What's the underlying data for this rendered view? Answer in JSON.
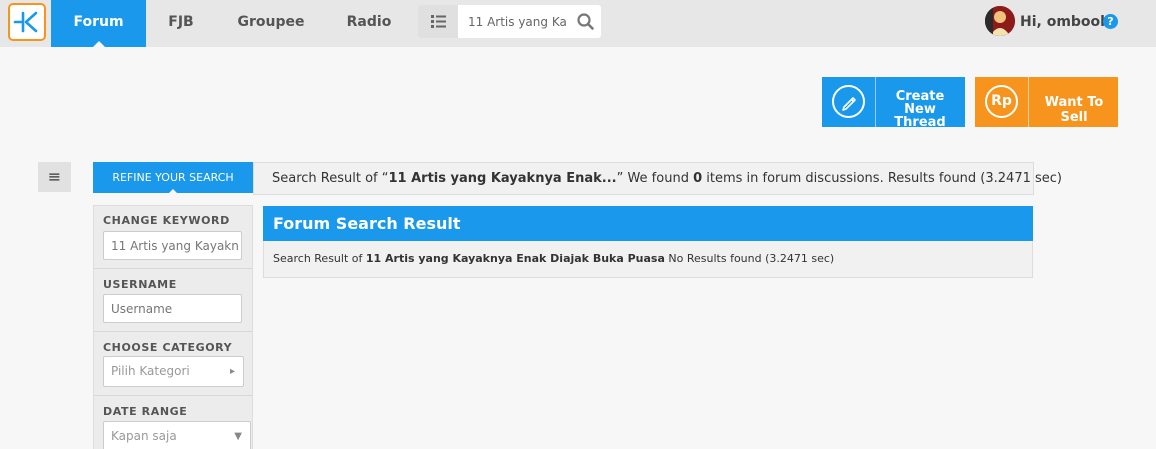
{
  "nav": {
    "tabs": [
      {
        "label": "Forum"
      },
      {
        "label": "FJB"
      },
      {
        "label": "Groupee"
      },
      {
        "label": "Radio"
      }
    ],
    "search_value": "11 Artis yang Ka",
    "user_greeting": "Hi, omboob",
    "help_glyph": "?"
  },
  "actions": {
    "create_line1": "Create New",
    "create_line2": "Thread",
    "sell_label": "Want To Sell",
    "sell_icon_text": "Rp"
  },
  "toggle_glyph": "≡",
  "refine": {
    "tab_label": "REFINE YOUR SEARCH",
    "result_prefix": "Search Result of “",
    "result_keyword": "11 Artis yang Kayaknya Enak...",
    "result_mid": "” We found ",
    "result_count": "0",
    "result_suffix": " items in forum discussions. Results found (3.2471 sec)"
  },
  "sidebar": {
    "keyword_label": "CHANGE KEYWORD",
    "keyword_value": "11 Artis yang Kayakn",
    "username_label": "USERNAME",
    "username_placeholder": "Username",
    "category_label": "CHOOSE CATEGORY",
    "category_value": "Pilih Kategori",
    "date_label": "DATE RANGE",
    "date_value": "Kapan saja"
  },
  "forum_result": {
    "title": "Forum Search Result",
    "prefix": "Search Result of ",
    "keyword": "11 Artis yang Kayaknya Enak Diajak Buka Puasa",
    "suffix": " No Results found (3.2471 sec)"
  },
  "colors": {
    "accent_blue": "#1998ec",
    "accent_orange": "#f7941d"
  }
}
